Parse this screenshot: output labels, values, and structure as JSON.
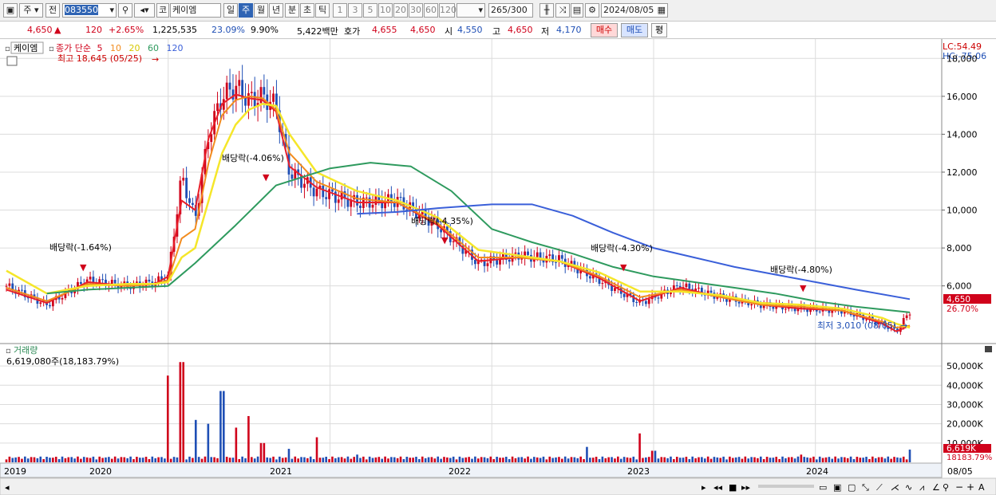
{
  "toolbar": {
    "period_label": "주",
    "prev_label": "전",
    "code": "083550",
    "market_label": "코",
    "stock_name": "케이엠",
    "intervals": [
      "일",
      "주",
      "월",
      "년",
      "분",
      "초",
      "틱"
    ],
    "selected_interval": "주",
    "counts": [
      "1",
      "3",
      "5",
      "10",
      "20",
      "30",
      "60",
      "120"
    ],
    "display_count": "265",
    "total_count": "/300",
    "date": "2024/08/05"
  },
  "quote": {
    "price": "4,650",
    "change": "120",
    "change_pct": "+2.65%",
    "volume": "1,225,535",
    "turnover_pct": "23.09%",
    "rate2": "9.90%",
    "amount": "5,422백만",
    "hoga_label": "호가",
    "hoga_ask": "4,655",
    "hoga_bid": "4,650",
    "open_label": "시",
    "open": "4,550",
    "high_label": "고",
    "high": "4,650",
    "low_label": "저",
    "low": "4,170",
    "buy_label": "매수",
    "sell_label": "매도",
    "eval_label": "평"
  },
  "colors": {
    "up": "#d0021b",
    "down": "#1f4fb5",
    "ma5": "#e8202a",
    "ma10": "#f28c1e",
    "ma20": "#f5e62a",
    "ma60": "#2e9a5e",
    "ma120": "#3a5fd9",
    "grid": "#dcdcdc"
  },
  "chart_data": [
    {
      "type": "candlestick",
      "name": "케이엠",
      "legend_prefix": "종가 단순",
      "ma_periods": [
        "5",
        "10",
        "20",
        "60",
        "120"
      ],
      "y_axis_labels": [
        "18,000",
        "16,000",
        "14,000",
        "12,000",
        "10,000",
        "8,000",
        "6,000"
      ],
      "ylim": [
        3000,
        18600
      ],
      "x_axis_labels": [
        "2019",
        "2020",
        "2021",
        "2022",
        "2023",
        "2024",
        "08/05"
      ],
      "lc_label": "LC:54.49",
      "hc_label": "HC:-75.06",
      "price_tag": "4,650",
      "pct_tag": "26.70%",
      "x_start": "2019-01",
      "x_end": "2024-08",
      "annotations": {
        "high": "최고 18,645 (05/25)",
        "low": "최저 3,010 (08/05)",
        "dividends": [
          "배당락(-1.64%)",
          "배당락(-4.06%)",
          "배당락(-4.35%)",
          "배당락(-4.30%)",
          "배당락(-4.80%)"
        ]
      },
      "series": [
        {
          "name": "close",
          "points": [
            [
              "2019-01",
              6000
            ],
            [
              "2019-04",
              5000
            ],
            [
              "2019-07",
              6300
            ],
            [
              "2019-10",
              6000
            ],
            [
              "2019-12",
              6200
            ],
            [
              "2020-01",
              6500
            ],
            [
              "2020-02",
              11800
            ],
            [
              "2020-03",
              9500
            ],
            [
              "2020-04",
              14000
            ],
            [
              "2020-05",
              16000
            ],
            [
              "2020-06",
              16500
            ],
            [
              "2020-07",
              15800
            ],
            [
              "2020-08",
              16000
            ],
            [
              "2020-09",
              15500
            ],
            [
              "2020-10",
              12000
            ],
            [
              "2020-12",
              11000
            ],
            [
              "2021-03",
              10400
            ],
            [
              "2021-06",
              10500
            ],
            [
              "2021-09",
              9200
            ],
            [
              "2021-12",
              7200
            ],
            [
              "2022-03",
              7600
            ],
            [
              "2022-06",
              7400
            ],
            [
              "2022-09",
              6300
            ],
            [
              "2022-12",
              5100
            ],
            [
              "2023-03",
              6000
            ],
            [
              "2023-06",
              5400
            ],
            [
              "2023-09",
              5000
            ],
            [
              "2023-12",
              4800
            ],
            [
              "2024-03",
              4700
            ],
            [
              "2024-06",
              4000
            ],
            [
              "2024-07",
              3600
            ],
            [
              "2024-08",
              4650
            ]
          ]
        },
        {
          "name": "5",
          "points": [
            [
              "2019-01",
              5800
            ],
            [
              "2019-04",
              5100
            ],
            [
              "2019-07",
              6200
            ],
            [
              "2019-10",
              6000
            ],
            [
              "2019-12",
              6100
            ],
            [
              "2020-01",
              6500
            ],
            [
              "2020-02",
              10500
            ],
            [
              "2020-03",
              10000
            ],
            [
              "2020-04",
              13800
            ],
            [
              "2020-05",
              15600
            ],
            [
              "2020-06",
              16100
            ],
            [
              "2020-07",
              15900
            ],
            [
              "2020-08",
              15800
            ],
            [
              "2020-09",
              15200
            ],
            [
              "2020-10",
              12300
            ],
            [
              "2020-12",
              11200
            ],
            [
              "2021-03",
              10400
            ],
            [
              "2021-06",
              10400
            ],
            [
              "2021-09",
              9200
            ],
            [
              "2021-12",
              7300
            ],
            [
              "2022-03",
              7500
            ],
            [
              "2022-06",
              7300
            ],
            [
              "2022-09",
              6400
            ],
            [
              "2022-12",
              5200
            ],
            [
              "2023-03",
              5900
            ],
            [
              "2023-06",
              5400
            ],
            [
              "2023-09",
              5000
            ],
            [
              "2023-12",
              4800
            ],
            [
              "2024-03",
              4700
            ],
            [
              "2024-06",
              4000
            ],
            [
              "2024-07",
              3600
            ],
            [
              "2024-08",
              3900
            ]
          ]
        },
        {
          "name": "10",
          "points": [
            [
              "2019-01",
              5900
            ],
            [
              "2019-04",
              5200
            ],
            [
              "2019-07",
              6100
            ],
            [
              "2019-10",
              6000
            ],
            [
              "2019-12",
              6100
            ],
            [
              "2020-01",
              6300
            ],
            [
              "2020-02",
              8500
            ],
            [
              "2020-03",
              9000
            ],
            [
              "2020-04",
              12500
            ],
            [
              "2020-05",
              15000
            ],
            [
              "2020-06",
              15800
            ],
            [
              "2020-07",
              16000
            ],
            [
              "2020-08",
              15900
            ],
            [
              "2020-09",
              15300
            ],
            [
              "2020-10",
              13000
            ],
            [
              "2020-12",
              11500
            ],
            [
              "2021-03",
              10600
            ],
            [
              "2021-06",
              10400
            ],
            [
              "2021-09",
              9300
            ],
            [
              "2021-12",
              7500
            ],
            [
              "2022-03",
              7500
            ],
            [
              "2022-06",
              7300
            ],
            [
              "2022-09",
              6500
            ],
            [
              "2022-12",
              5400
            ],
            [
              "2023-03",
              5800
            ],
            [
              "2023-06",
              5400
            ],
            [
              "2023-09",
              5000
            ],
            [
              "2023-12",
              4900
            ],
            [
              "2024-03",
              4700
            ],
            [
              "2024-06",
              4100
            ],
            [
              "2024-07",
              3800
            ],
            [
              "2024-08",
              3900
            ]
          ]
        },
        {
          "name": "20",
          "points": [
            [
              "2019-01",
              6800
            ],
            [
              "2019-04",
              5600
            ],
            [
              "2019-07",
              6000
            ],
            [
              "2019-10",
              6100
            ],
            [
              "2019-12",
              6100
            ],
            [
              "2020-01",
              6200
            ],
            [
              "2020-02",
              7500
            ],
            [
              "2020-03",
              8000
            ],
            [
              "2020-04",
              10500
            ],
            [
              "2020-05",
              13000
            ],
            [
              "2020-06",
              14500
            ],
            [
              "2020-07",
              15300
            ],
            [
              "2020-08",
              15600
            ],
            [
              "2020-09",
              15500
            ],
            [
              "2020-10",
              14000
            ],
            [
              "2020-12",
              12000
            ],
            [
              "2021-03",
              11000
            ],
            [
              "2021-06",
              10500
            ],
            [
              "2021-09",
              9600
            ],
            [
              "2021-12",
              7900
            ],
            [
              "2022-03",
              7600
            ],
            [
              "2022-06",
              7300
            ],
            [
              "2022-09",
              6700
            ],
            [
              "2022-12",
              5700
            ],
            [
              "2023-03",
              5700
            ],
            [
              "2023-06",
              5500
            ],
            [
              "2023-09",
              5100
            ],
            [
              "2023-12",
              5000
            ],
            [
              "2024-03",
              4800
            ],
            [
              "2024-06",
              4300
            ],
            [
              "2024-07",
              4000
            ],
            [
              "2024-08",
              3800
            ]
          ]
        },
        {
          "name": "60",
          "points": [
            [
              "2019-04",
              5600
            ],
            [
              "2019-07",
              5800
            ],
            [
              "2019-10",
              5900
            ],
            [
              "2020-01",
              6000
            ],
            [
              "2020-03",
              7200
            ],
            [
              "2020-06",
              9200
            ],
            [
              "2020-09",
              11300
            ],
            [
              "2021-01",
              12200
            ],
            [
              "2021-04",
              12500
            ],
            [
              "2021-07",
              12300
            ],
            [
              "2021-10",
              11000
            ],
            [
              "2022-01",
              9000
            ],
            [
              "2022-04",
              8300
            ],
            [
              "2022-07",
              7700
            ],
            [
              "2022-10",
              7000
            ],
            [
              "2023-01",
              6500
            ],
            [
              "2023-04",
              6200
            ],
            [
              "2023-07",
              5900
            ],
            [
              "2023-10",
              5600
            ],
            [
              "2024-01",
              5200
            ],
            [
              "2024-04",
              4900
            ],
            [
              "2024-08",
              4600
            ]
          ]
        },
        {
          "name": "120",
          "points": [
            [
              "2021-03",
              9800
            ],
            [
              "2021-06",
              9900
            ],
            [
              "2021-09",
              10100
            ],
            [
              "2022-01",
              10300
            ],
            [
              "2022-04",
              10300
            ],
            [
              "2022-07",
              9700
            ],
            [
              "2022-10",
              8800
            ],
            [
              "2023-01",
              8000
            ],
            [
              "2023-04",
              7500
            ],
            [
              "2023-07",
              7000
            ],
            [
              "2023-10",
              6600
            ],
            [
              "2024-01",
              6200
            ],
            [
              "2024-04",
              5800
            ],
            [
              "2024-08",
              5300
            ]
          ]
        }
      ]
    },
    {
      "type": "bar",
      "name": "거래량",
      "legend": "6,619,080주(18,183.79%)",
      "y_axis_labels": [
        "50,000K",
        "40,000K",
        "30,000K",
        "20,000K",
        "10,000K"
      ],
      "ylim": [
        0,
        55000
      ],
      "last_tag": "6,619K",
      "pct_tag": "18183.79%",
      "points": [
        [
          "2020-01",
          45000
        ],
        [
          "2020-02",
          52000
        ],
        [
          "2020-03",
          22000
        ],
        [
          "2020-04",
          20000
        ],
        [
          "2020-05",
          37000
        ],
        [
          "2020-06",
          18000
        ],
        [
          "2020-07",
          24000
        ],
        [
          "2020-08",
          10000
        ],
        [
          "2020-10",
          7000
        ],
        [
          "2020-12",
          13000
        ],
        [
          "2021-03",
          4000
        ],
        [
          "2022-08",
          8000
        ],
        [
          "2022-12",
          15000
        ],
        [
          "2023-01",
          6000
        ],
        [
          "2023-12",
          4000
        ],
        [
          "2024-08",
          6600
        ]
      ]
    }
  ]
}
